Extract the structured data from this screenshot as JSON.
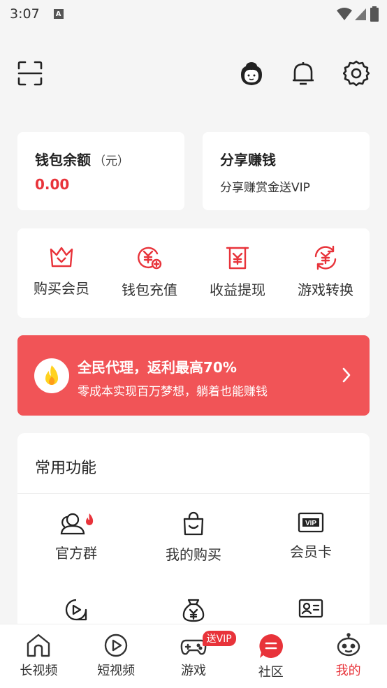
{
  "status": {
    "time": "3:07",
    "notif_letter": "A"
  },
  "wallet": {
    "title": "钱包余额",
    "unit": "（元）",
    "value": "0.00"
  },
  "share": {
    "title": "分享赚钱",
    "subtitle": "分享赚赏金送VIP"
  },
  "quick_actions": [
    {
      "label": "购买会员",
      "icon": "crown-icon"
    },
    {
      "label": "钱包充值",
      "icon": "yuan-add-icon"
    },
    {
      "label": "收益提现",
      "icon": "withdraw-icon"
    },
    {
      "label": "游戏转换",
      "icon": "exchange-icon"
    }
  ],
  "banner": {
    "title": "全民代理，返利最高70%",
    "subtitle": "零成本实现百万梦想，躺着也能赚钱"
  },
  "features": {
    "title": "常用功能",
    "items": [
      {
        "label": "官方群",
        "icon": "group-fire-icon"
      },
      {
        "label": "我的购买",
        "icon": "shopping-bag-icon"
      },
      {
        "label": "会员卡",
        "icon": "vip-card-icon"
      }
    ]
  },
  "tabs": [
    {
      "label": "长视频",
      "icon": "home-icon"
    },
    {
      "label": "短视频",
      "icon": "play-icon"
    },
    {
      "label": "游戏",
      "icon": "gamepad-icon",
      "badge": "送VIP"
    },
    {
      "label": "社区",
      "icon": "community-icon"
    },
    {
      "label": "我的",
      "icon": "robot-icon",
      "active": true
    }
  ],
  "colors": {
    "accent": "#e8333a",
    "banner": "#f15457",
    "background": "#f5f5f5"
  }
}
